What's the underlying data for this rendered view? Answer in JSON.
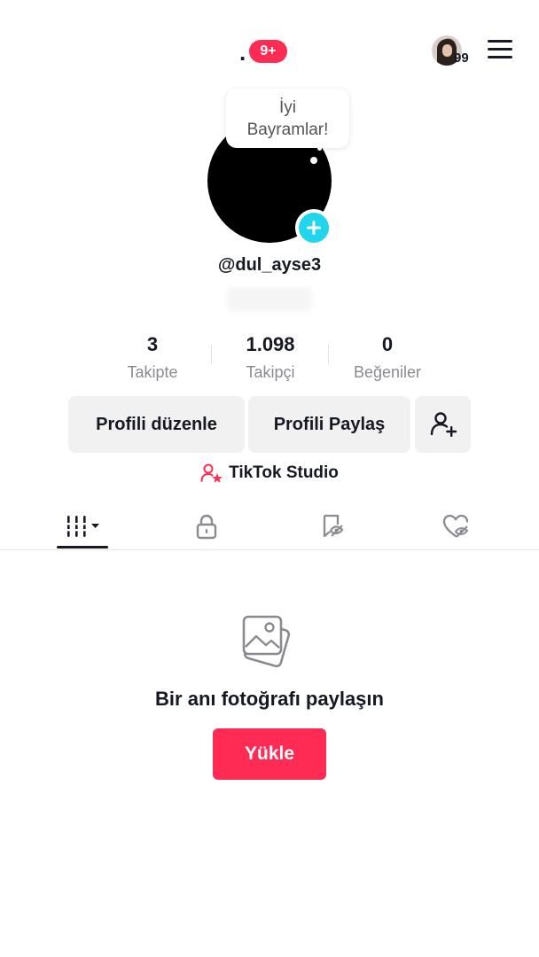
{
  "header": {
    "title_dot": ".",
    "notification_badge": "9+",
    "avatar_count": "99"
  },
  "profile": {
    "bubble_line1": "İyi",
    "bubble_line2": "Bayramlar!",
    "username": "@dul_ayse3"
  },
  "stats": [
    {
      "value": "3",
      "label": "Takipte"
    },
    {
      "value": "1.098",
      "label": "Takipçi"
    },
    {
      "value": "0",
      "label": "Beğeniler"
    }
  ],
  "actions": {
    "edit_profile": "Profili düzenle",
    "share_profile": "Profili Paylaş"
  },
  "studio": {
    "label": "TikTok Studio"
  },
  "tabs": [
    {
      "icon": "videos-grid-icon",
      "active": true
    },
    {
      "icon": "lock-icon",
      "active": false
    },
    {
      "icon": "reposts-icon",
      "active": false
    },
    {
      "icon": "liked-heart-icon",
      "active": false
    }
  ],
  "empty_state": {
    "icon": "photo-stack-icon",
    "text": "Bir anı fotoğrafı paylaşın",
    "button": "Yükle"
  },
  "colors": {
    "accent": "#fe2c55",
    "plus": "#20d5ec",
    "button_bg": "#f1f1f2",
    "text": "#161823",
    "muted": "#8a8b91"
  }
}
